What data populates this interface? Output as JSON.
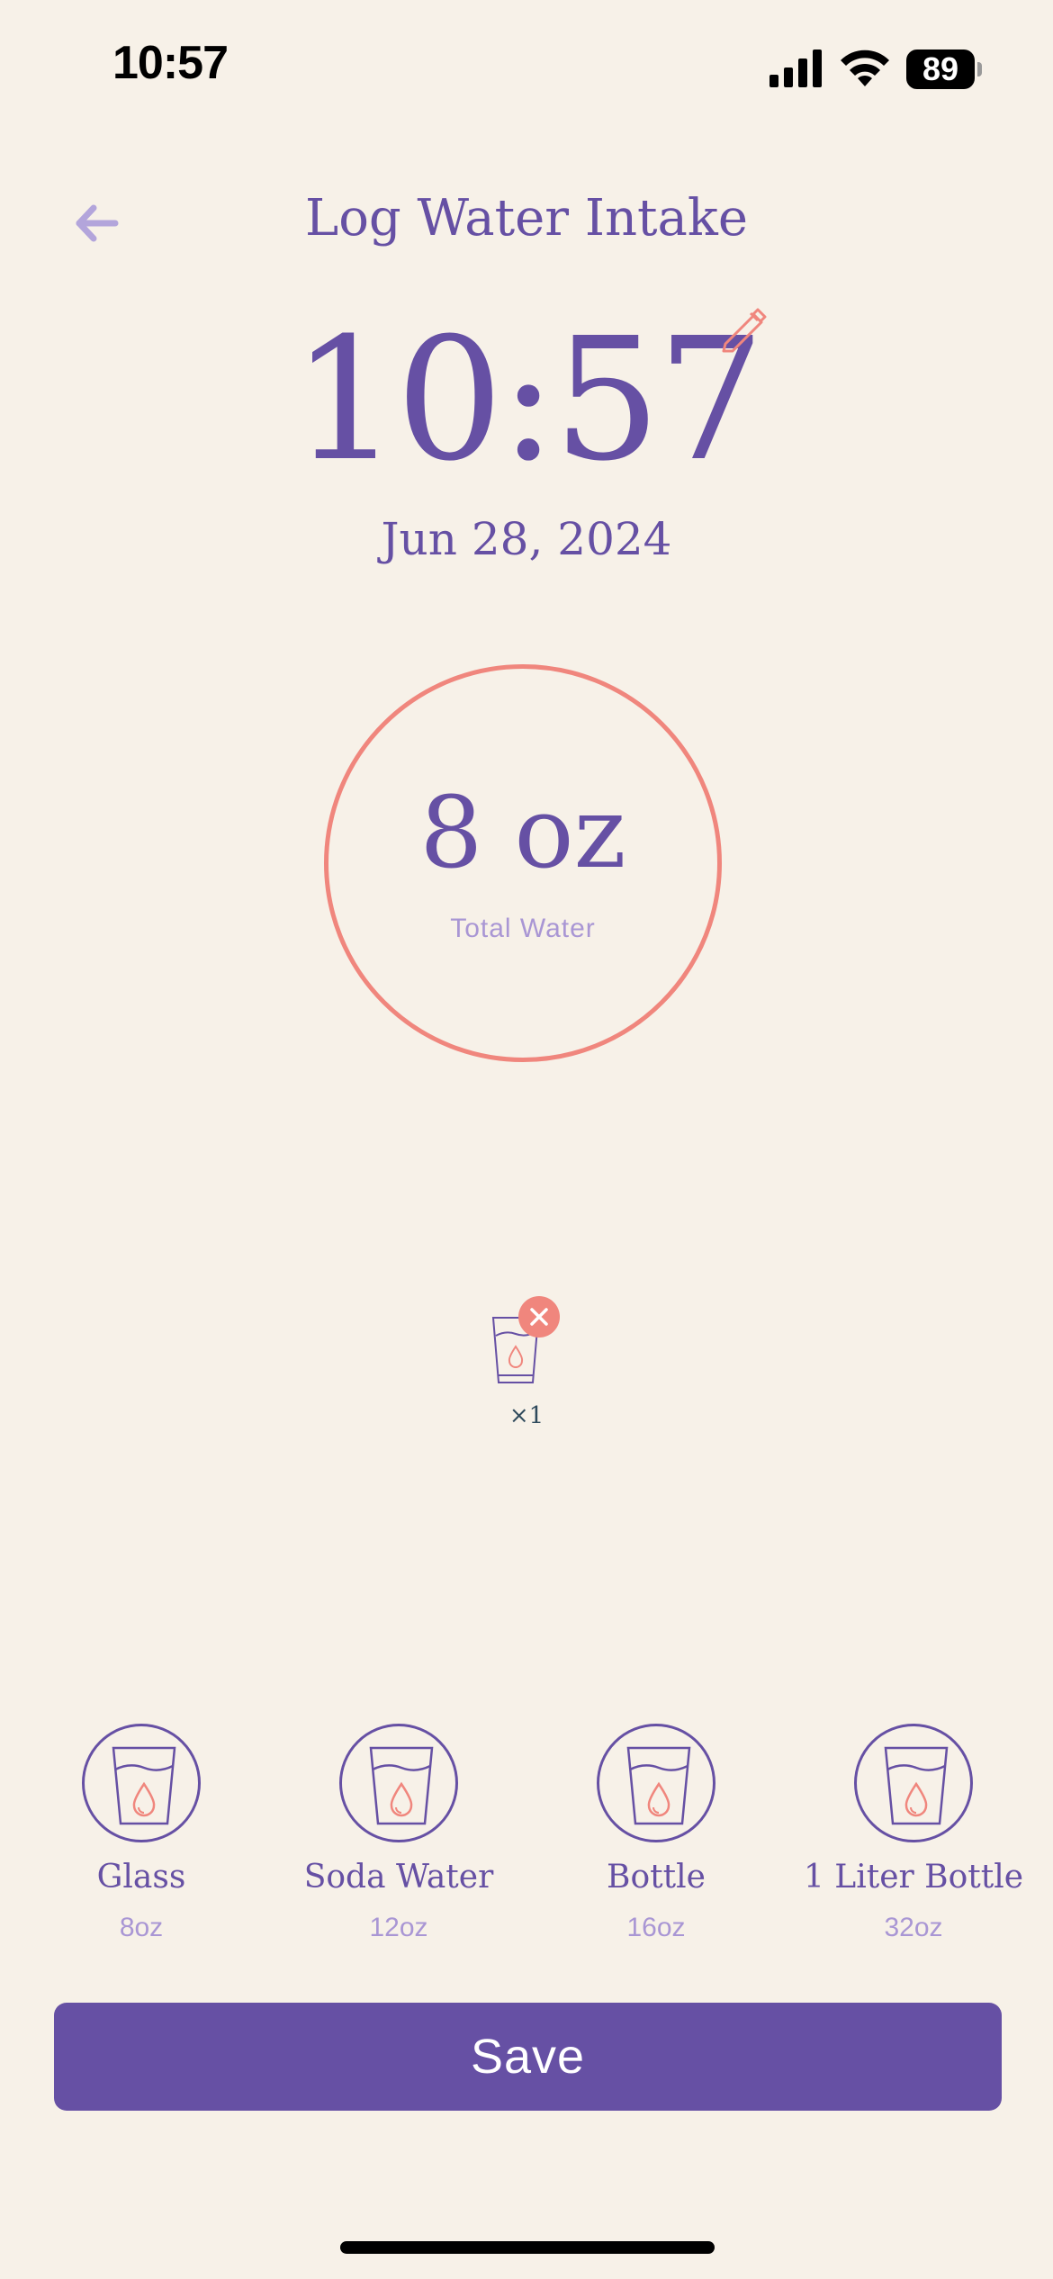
{
  "status_bar": {
    "time": "10:57",
    "battery": "89"
  },
  "header": {
    "title": "Log Water Intake",
    "back_icon": "arrow-left-icon"
  },
  "entry": {
    "time": "10:57",
    "date": "Jun 28, 2024",
    "edit_icon": "pencil-icon"
  },
  "total": {
    "value": "8 oz",
    "label": "Total Water"
  },
  "logged": {
    "count_label": "×1",
    "remove_icon": "close-icon"
  },
  "presets": [
    {
      "name": "Glass",
      "size": "8oz"
    },
    {
      "name": "Soda Water",
      "size": "12oz"
    },
    {
      "name": "Bottle",
      "size": "16oz"
    },
    {
      "name": "1 Liter Bottle",
      "size": "32oz"
    }
  ],
  "actions": {
    "save_label": "Save"
  },
  "colors": {
    "background": "#F7F1E8",
    "primary": "#6650A4",
    "accent": "#F0867D",
    "muted": "#A996D4"
  }
}
